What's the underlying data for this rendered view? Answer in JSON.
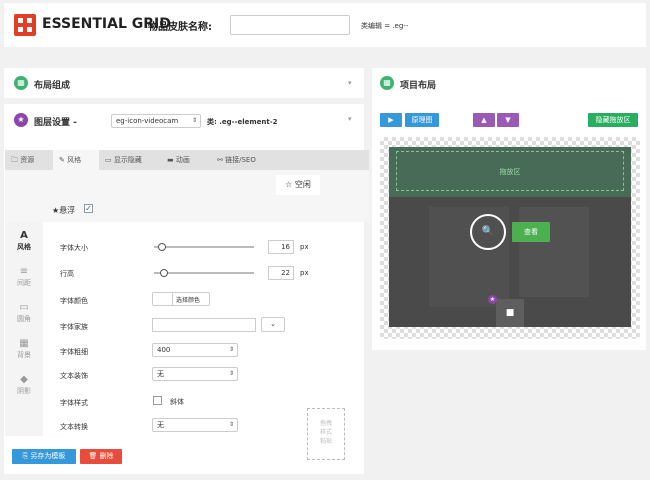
{
  "header": {
    "brand": "ESSENTIAL GRID",
    "skin_name_label": "物品皮肤名称:",
    "skin_name_value": "",
    "class_label": "类编辑 = .eg--"
  },
  "layout_panel": {
    "title": "布局组成"
  },
  "layer_panel": {
    "title": "图层设置 -",
    "element_select": "eg-icon-videocam",
    "class_text": "类: .eg--element-2",
    "tabs": [
      {
        "label": "资源",
        "icon": "file-icon"
      },
      {
        "label": "风格",
        "icon": "brush-icon"
      },
      {
        "label": "显示隐藏",
        "icon": "monitor-icon"
      },
      {
        "label": "动画",
        "icon": "film-icon"
      },
      {
        "label": "链接/SEO",
        "icon": "link-icon"
      }
    ],
    "active_tab": "风格",
    "idle_button": "☆ 空闲",
    "hover_label": "★悬浮",
    "hover_checked": true,
    "sidebar": [
      {
        "label": "风格",
        "icon": "A"
      },
      {
        "label": "间距",
        "icon": "≡"
      },
      {
        "label": "圆角",
        "icon": "▭"
      },
      {
        "label": "背景",
        "icon": "▦"
      },
      {
        "label": "阴影",
        "icon": "◆"
      }
    ],
    "fields": {
      "font_size_label": "字体大小",
      "font_size_value": "16",
      "line_height_label": "行高",
      "line_height_value": "22",
      "px_unit": "px",
      "font_color_label": "字体颜色",
      "pick_color_label": "选择颜色",
      "font_family_label": "字体家族",
      "font_weight_label": "字体粗细",
      "font_weight_value": "400",
      "text_decoration_label": "文本装饰",
      "text_decoration_value": "无",
      "font_style_label": "字体样式",
      "italic_label": "斜体",
      "text_transform_label": "文本转换",
      "text_transform_value": "无",
      "copy_style_hint": "拖拽样式粘贴"
    },
    "save_template_label": "另存为模板",
    "delete_label": "删除"
  },
  "item_layout_panel": {
    "title": "项目布局",
    "play_label": "▶",
    "original_image_label": "原理图",
    "up_label": "▲",
    "down_label": "▼",
    "hide_dropzone_label": "隐藏拖放区",
    "dropzone_label": "拖放区",
    "view_button_label": "查看"
  },
  "colors": {
    "brand_red": "#e03f25",
    "accent_green": "#3cb371",
    "accent_purple": "#8e44ad",
    "button_blue": "#3498db",
    "button_red": "#e74c3c"
  }
}
